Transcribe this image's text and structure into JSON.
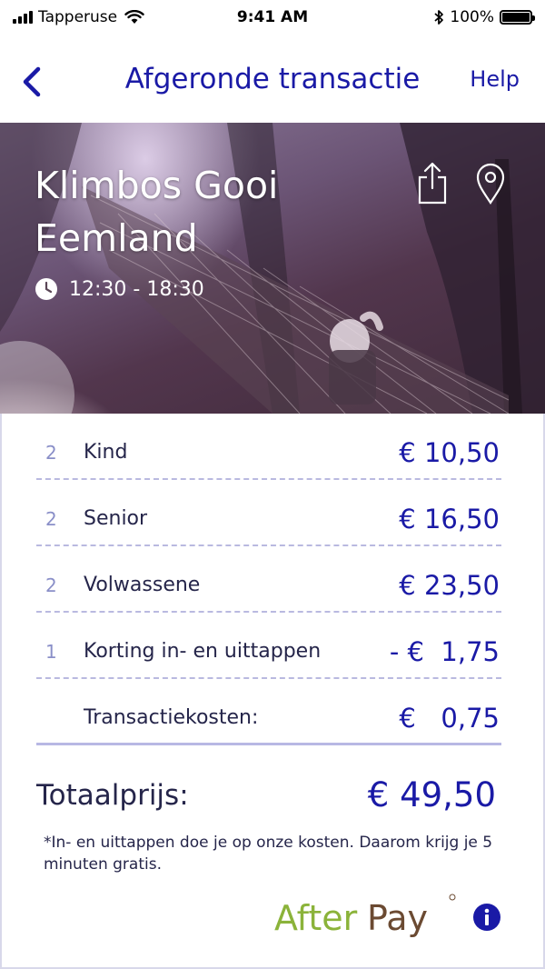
{
  "status_bar": {
    "carrier": "Tapperuse",
    "time": "9:41 AM",
    "battery": "100%"
  },
  "navbar": {
    "title": "Afgeronde transactie",
    "help_label": "Help",
    "back_icon": "chevron-left-icon"
  },
  "hero": {
    "title": "Klimbos Gooi Eemland",
    "time": "12:30 - 18:30",
    "icons": [
      "share-icon",
      "location-pin-icon",
      "clock-icon"
    ]
  },
  "items": [
    {
      "qty": "2",
      "label": "Kind",
      "amount": "€ 10,50"
    },
    {
      "qty": "2",
      "label": "Senior",
      "amount": "€ 16,50"
    },
    {
      "qty": "2",
      "label": "Volwassene",
      "amount": "€ 23,50"
    },
    {
      "qty": "1",
      "label": "Korting in- en uittappen",
      "amount": "- €  1,75"
    },
    {
      "qty": "",
      "label": "Transactiekosten:",
      "amount": "€   0,75"
    }
  ],
  "total": {
    "label": "Totaalprijs:",
    "amount": "€ 49,50"
  },
  "note": "*In- en uittappen doe je op onze kosten. Daarom krijg je 5 minuten gratis.",
  "afterpay": {
    "brand_after": "After",
    "brand_pay": "Pay",
    "info_icon": "info-icon"
  },
  "colors": {
    "accent": "#1a1aa6",
    "afterpay_green": "#8bb33a",
    "afterpay_brown": "#6b4a32",
    "divider": "#b9b9e0"
  }
}
